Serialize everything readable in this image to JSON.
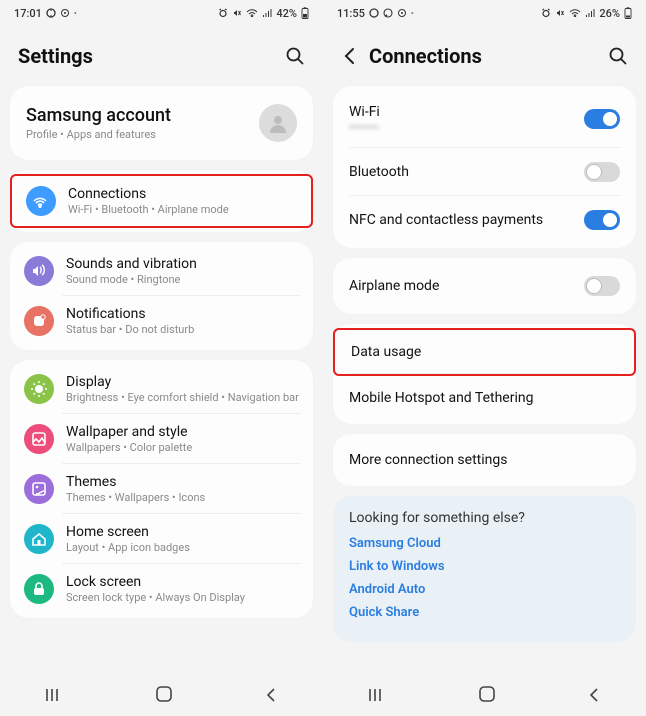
{
  "left": {
    "status": {
      "time": "17:01",
      "battery": "42%"
    },
    "title": "Settings",
    "account": {
      "title": "Samsung account",
      "sub": "Profile  •  Apps and features"
    },
    "groups": [
      {
        "rows": [
          {
            "id": "connections",
            "title": "Connections",
            "sub": "Wi-Fi  •  Bluetooth  •  Airplane mode",
            "color": "#3e9bff",
            "highlight": true
          }
        ]
      },
      {
        "rows": [
          {
            "id": "sounds",
            "title": "Sounds and vibration",
            "sub": "Sound mode  •  Ringtone",
            "color": "#8b7bd8"
          },
          {
            "id": "notifications",
            "title": "Notifications",
            "sub": "Status bar  •  Do not disturb",
            "color": "#e87264"
          }
        ]
      },
      {
        "rows": [
          {
            "id": "display",
            "title": "Display",
            "sub": "Brightness  •  Eye comfort shield  •  Navigation bar",
            "color": "#8bc34a"
          },
          {
            "id": "wallpaper",
            "title": "Wallpaper and style",
            "sub": "Wallpapers  •  Color palette",
            "color": "#ec4d7a"
          },
          {
            "id": "themes",
            "title": "Themes",
            "sub": "Themes  •  Wallpapers  •  Icons",
            "color": "#9b6edc"
          },
          {
            "id": "home",
            "title": "Home screen",
            "sub": "Layout  •  App icon badges",
            "color": "#1fb6c9"
          },
          {
            "id": "lock",
            "title": "Lock screen",
            "sub": "Screen lock type  •  Always On Display",
            "color": "#1eb980"
          }
        ]
      }
    ]
  },
  "right": {
    "status": {
      "time": "11:55",
      "battery": "26%"
    },
    "title": "Connections",
    "groups": [
      {
        "rows": [
          {
            "id": "wifi",
            "title": "Wi-Fi",
            "sub": "••••••••",
            "toggle": "on"
          },
          {
            "id": "bluetooth",
            "title": "Bluetooth",
            "toggle": "off"
          },
          {
            "id": "nfc",
            "title": "NFC and contactless payments",
            "toggle": "on"
          }
        ]
      },
      {
        "rows": [
          {
            "id": "airplane",
            "title": "Airplane mode",
            "toggle": "off"
          }
        ]
      },
      {
        "rows": [
          {
            "id": "data",
            "title": "Data usage",
            "highlight": true
          },
          {
            "id": "hotspot",
            "title": "Mobile Hotspot and Tethering"
          }
        ]
      },
      {
        "rows": [
          {
            "id": "more",
            "title": "More connection settings"
          }
        ]
      }
    ],
    "links": {
      "title": "Looking for something else?",
      "items": [
        "Samsung Cloud",
        "Link to Windows",
        "Android Auto",
        "Quick Share"
      ]
    }
  }
}
